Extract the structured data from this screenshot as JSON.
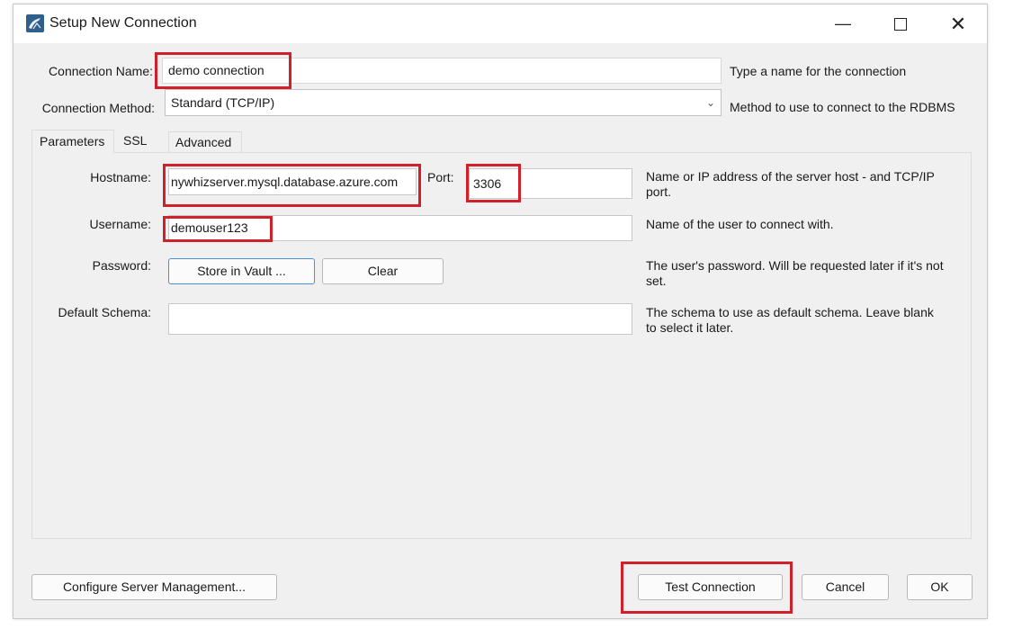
{
  "window": {
    "title": "Setup New Connection",
    "minimize_icon": "minimize-icon",
    "maximize_icon": "maximize-icon",
    "close_icon": "close-icon"
  },
  "connection_name": {
    "label": "Connection Name:",
    "value": "demo connection",
    "help": "Type a name for the connection"
  },
  "connection_method": {
    "label": "Connection Method:",
    "value": "Standard (TCP/IP)",
    "help": "Method to use to connect to the RDBMS"
  },
  "tabs": [
    {
      "label": "Parameters",
      "active": true
    },
    {
      "label": "SSL",
      "active": false
    },
    {
      "label": "Advanced",
      "active": false
    }
  ],
  "parameters": {
    "hostname_label": "Hostname:",
    "hostname_value": "nywhizserver.mysql.database.azure.com",
    "port_label": "Port:",
    "port_value": "3306",
    "host_help": "Name or IP address of the server host - and TCP/IP port.",
    "username_label": "Username:",
    "username_value": "demouser123",
    "username_help": "Name of the user to connect with.",
    "password_label": "Password:",
    "store_vault_button": "Store in Vault ...",
    "clear_button": "Clear",
    "password_help": "The user's password. Will be requested later if it's not set.",
    "schema_label": "Default Schema:",
    "schema_value": "",
    "schema_help": "The schema to use as default schema. Leave blank to select it later."
  },
  "footer": {
    "configure_button": "Configure Server Management...",
    "test_button": "Test Connection",
    "cancel_button": "Cancel",
    "ok_button": "OK"
  },
  "colors": {
    "highlight": "#d0202a",
    "focus_border": "#4a90d9",
    "window_bg": "#f0f0f0"
  }
}
